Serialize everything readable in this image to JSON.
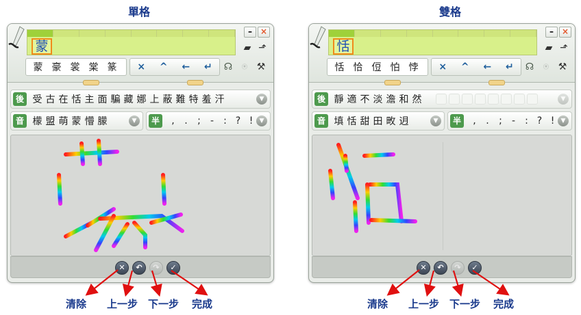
{
  "titles": {
    "left": "單格",
    "right": "雙格"
  },
  "window_buttons": {
    "minimize": "–",
    "close": "×"
  },
  "left": {
    "composition_char": "蒙",
    "candidates": [
      "蒙",
      "豪",
      "裳",
      "棠",
      "篆"
    ],
    "row1": {
      "tag": "後",
      "chars": [
        "受",
        "古",
        "在",
        "恬",
        "主",
        "面",
        "騙",
        "藏",
        "娜",
        "上",
        "蔽",
        "難",
        "特",
        "羞",
        "汗"
      ]
    },
    "row2": {
      "tag": "音",
      "chars": [
        "檬",
        "盟",
        "萌",
        "蒙",
        "懵",
        "朦"
      ]
    },
    "row3": {
      "tag": "半",
      "chars": [
        ",",
        ".",
        ";",
        "-",
        ":",
        "?",
        "!"
      ]
    }
  },
  "right": {
    "composition_char": "恬",
    "candidates": [
      "恬",
      "恰",
      "侸",
      "怕",
      "悖"
    ],
    "row1": {
      "tag": "後",
      "chars": [
        "靜",
        "適",
        "不",
        "淡",
        "澹",
        "和",
        "然"
      ]
    },
    "row2": {
      "tag": "音",
      "chars": [
        "填",
        "恬",
        "甜",
        "田",
        "畋",
        "迌"
      ]
    },
    "row3": {
      "tag": "半",
      "chars": [
        ",",
        ".",
        ";",
        "-",
        ":",
        "?",
        "!"
      ]
    }
  },
  "ctrl_glyphs": [
    "×",
    "^",
    "←",
    "↵"
  ],
  "annotations": [
    "清除",
    "上一步",
    "下一步",
    "完成"
  ],
  "colors": {
    "arrow": "#e01010",
    "label": "#1a3a8c",
    "composition_bg": "#d8f08a",
    "tag_bg": "#4d9a4d"
  }
}
